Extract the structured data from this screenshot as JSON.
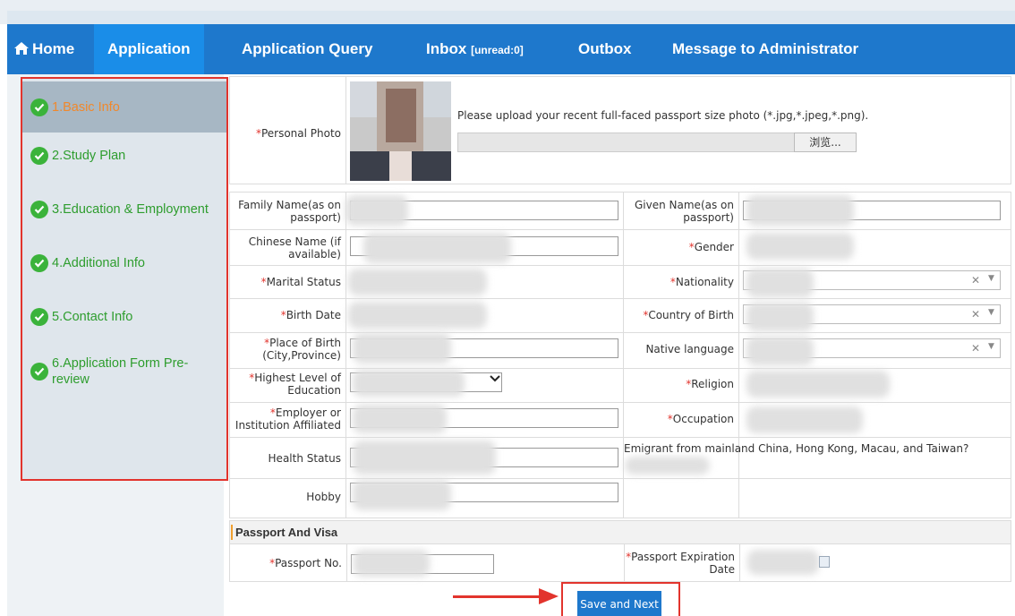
{
  "nav": {
    "home": "Home",
    "application": "Application",
    "application_query": "Application Query",
    "inbox": "Inbox",
    "inbox_badge": "[unread:0]",
    "outbox": "Outbox",
    "message_admin": "Message to Administrator"
  },
  "sidebar": {
    "items": [
      {
        "label": "1.Basic Info"
      },
      {
        "label": "2.Study Plan"
      },
      {
        "label": "3.Education & Employment"
      },
      {
        "label": "4.Additional Info"
      },
      {
        "label": "5.Contact Info"
      },
      {
        "label": "6.Application Form Pre-review"
      }
    ]
  },
  "photo": {
    "label": "Personal Photo",
    "hint": "Please upload your recent full-faced passport size photo (*.jpg,*.jpeg,*.png).",
    "browse_button": "浏览..."
  },
  "fields": {
    "family_name": "Family Name(as on passport)",
    "given_name": "Given Name(as on passport)",
    "chinese_name": "Chinese Name (if available)",
    "gender": "Gender",
    "marital_status": "Marital Status",
    "nationality": "Nationality",
    "birth_date": "Birth Date",
    "country_of_birth": "Country of Birth",
    "place_of_birth": "Place of Birth (City,Province)",
    "native_language": "Native language",
    "highest_education": "Highest Level of Education",
    "religion": "Religion",
    "employer": "Employer or Institution Affiliated",
    "occupation": "Occupation",
    "health_status": "Health Status",
    "emigrant_question": "Emigrant from mainland China, Hong Kong, Macau, and Taiwan?",
    "hobby": "Hobby"
  },
  "passport": {
    "section_title": "Passport And Visa",
    "passport_no": "Passport No.",
    "passport_expiration": "Passport Expiration Date"
  },
  "actions": {
    "save_next": "Save and Next"
  },
  "colors": {
    "nav_bg": "#1e78cc",
    "nav_active": "#1a8de8",
    "required": "#e2342d",
    "sidebar_done": "#2e9d2e",
    "sidebar_active_text": "#f0882c",
    "annotation": "#e2342d"
  },
  "icons": {
    "home": "home-icon",
    "step_done": "check-circle-icon",
    "select_clear": "clear-x-icon",
    "select_arrow": "dropdown-arrow-icon",
    "calendar": "calendar-icon"
  }
}
